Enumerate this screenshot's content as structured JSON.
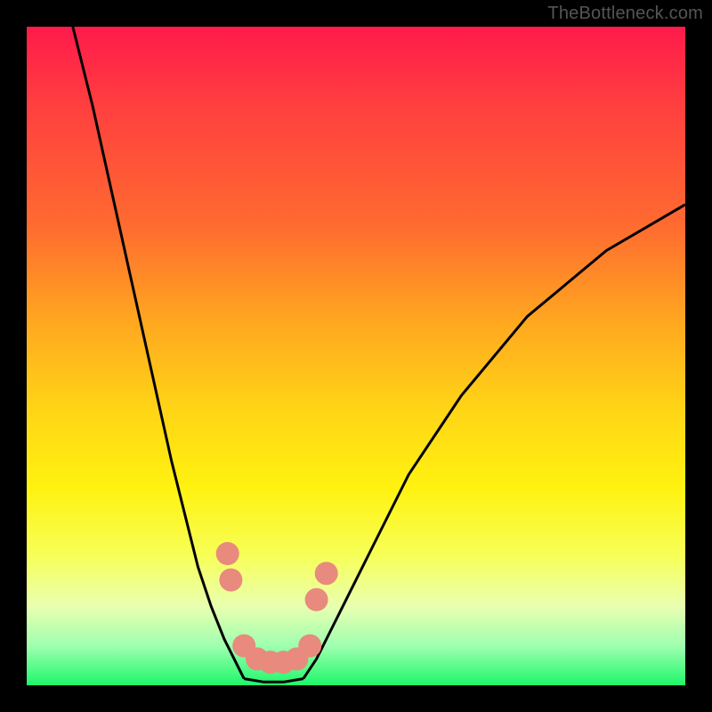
{
  "watermark": "TheBottleneck.com",
  "chart_data": {
    "type": "line",
    "title": "",
    "xlabel": "",
    "ylabel": "",
    "xlim": [
      0,
      100
    ],
    "ylim": [
      0,
      100
    ],
    "grid": false,
    "legend": false,
    "series": [
      {
        "name": "left-curve",
        "x": [
          7,
          10,
          14,
          18,
          22,
          26,
          28,
          30,
          32,
          33
        ],
        "y": [
          100,
          88,
          70,
          52,
          34,
          18,
          12,
          7,
          3,
          1
        ]
      },
      {
        "name": "right-curve",
        "x": [
          42,
          44,
          47,
          52,
          58,
          66,
          76,
          88,
          100
        ],
        "y": [
          1,
          4,
          10,
          20,
          32,
          44,
          56,
          66,
          73
        ]
      },
      {
        "name": "valley-base",
        "x": [
          33,
          36,
          39,
          42
        ],
        "y": [
          1,
          0.5,
          0.5,
          1
        ]
      }
    ],
    "markers": {
      "name": "salmon-dots",
      "color": "#e88a7d",
      "points": [
        {
          "x": 30.5,
          "y": 20
        },
        {
          "x": 31,
          "y": 16
        },
        {
          "x": 44,
          "y": 13
        },
        {
          "x": 45.5,
          "y": 17
        },
        {
          "x": 33,
          "y": 6
        },
        {
          "x": 35,
          "y": 4
        },
        {
          "x": 37,
          "y": 3.5
        },
        {
          "x": 39,
          "y": 3.5
        },
        {
          "x": 41,
          "y": 4
        },
        {
          "x": 43,
          "y": 6
        }
      ]
    },
    "background_gradient": {
      "direction": "vertical",
      "stops": [
        {
          "pos": 0,
          "color": "#ff1a4b"
        },
        {
          "pos": 30,
          "color": "#ff6a30"
        },
        {
          "pos": 58,
          "color": "#ffd416"
        },
        {
          "pos": 80,
          "color": "#f7ff55"
        },
        {
          "pos": 100,
          "color": "#1ef76a"
        }
      ]
    }
  }
}
